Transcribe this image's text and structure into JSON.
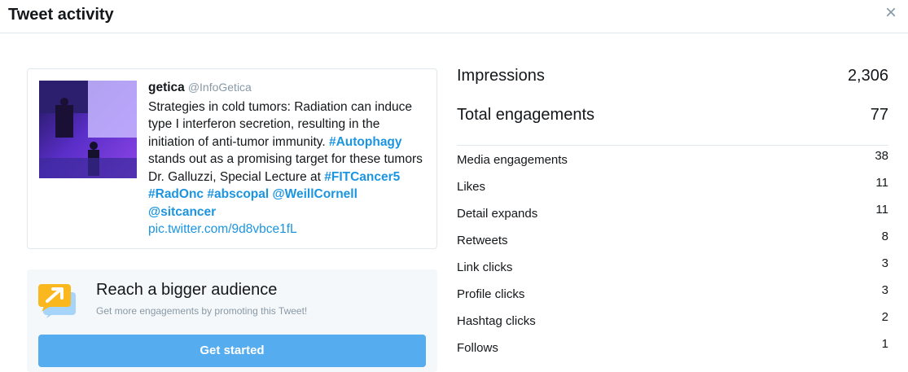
{
  "header": {
    "title": "Tweet activity",
    "close_glyph": "×"
  },
  "tweet": {
    "name": "getica",
    "handle": "@InfoGetica",
    "text_part1": "Strategies in cold tumors: Radiation can induce type I interferon secretion, resulting in the initiation of anti-tumor immunity.",
    "hashtag_autophagy": "#Autophagy",
    "text_part2": " stands out as a promising target for these tumors Dr. Galluzzi, Special Lecture at ",
    "hashtag_fitcancer": "#FITCancer5",
    "hashtag_radonc": "#RadOnc",
    "hashtag_abscopal": "#abscopal",
    "mention_weill": "@WeillCornell",
    "mention_sitc": "@sitcancer",
    "pic_link": "pic.twitter.com/9d8vbce1fL"
  },
  "promo": {
    "title": "Reach a bigger audience",
    "subtitle": "Get more engagements by promoting this Tweet!",
    "button_label": "Get started",
    "icon": "promote-arrow-icon",
    "accent_color": "#55acee",
    "icon_color": "#fab81e"
  },
  "stats": {
    "impressions": {
      "label": "Impressions",
      "value": "2,306"
    },
    "total_engagements": {
      "label": "Total engagements",
      "value": "77"
    },
    "rows": [
      {
        "label": "Media engagements",
        "value": "38"
      },
      {
        "label": "Likes",
        "value": "11"
      },
      {
        "label": "Detail expands",
        "value": "11"
      },
      {
        "label": "Retweets",
        "value": "8"
      },
      {
        "label": "Link clicks",
        "value": "3"
      },
      {
        "label": "Profile clicks",
        "value": "3"
      },
      {
        "label": "Hashtag clicks",
        "value": "2"
      },
      {
        "label": "Follows",
        "value": "1"
      }
    ]
  }
}
